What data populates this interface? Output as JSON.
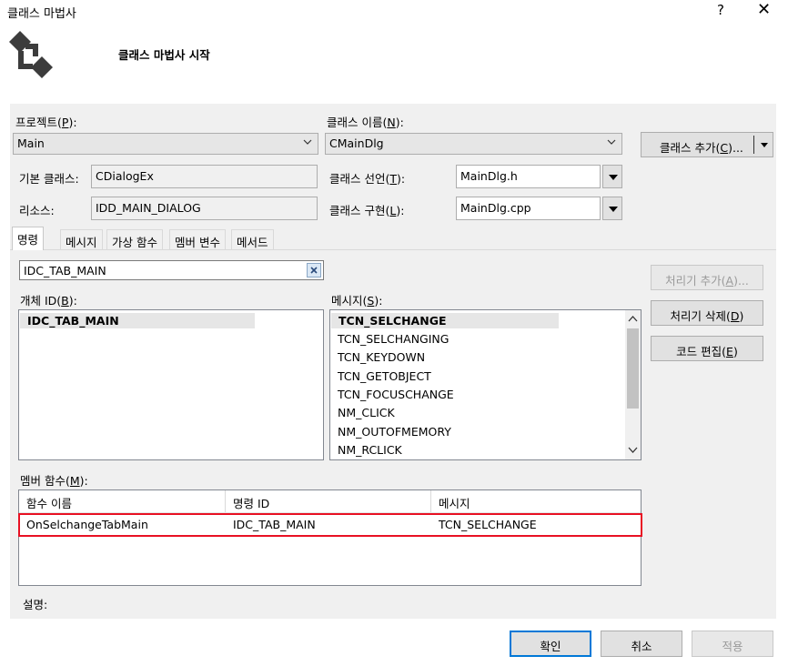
{
  "window": {
    "title": "클래스 마법사",
    "help": "?",
    "close": "✕"
  },
  "header": {
    "title": "클래스 마법사 시작"
  },
  "form": {
    "project_label": "프로젝트(",
    "project_key": "P",
    "project_close": "):",
    "project_value": "Main",
    "classname_label": "클래스 이름(",
    "classname_key": "N",
    "classname_close": "):",
    "classname_value": "CMainDlg",
    "add_class_label": "클래스 추가(",
    "add_class_key": "C",
    "add_class_close": ")...",
    "base_label": "기본 클래스:",
    "base_value": "CDialogEx",
    "decl_label": "클래스 선언(",
    "decl_key": "T",
    "decl_close": "):",
    "decl_value": "MainDlg.h",
    "resource_label": "리소스:",
    "resource_value": "IDD_MAIN_DIALOG",
    "impl_label": "클래스 구현(",
    "impl_key": "L",
    "impl_close": "):",
    "impl_value": "MainDlg.cpp"
  },
  "tabs": [
    "명령",
    "메시지",
    "가상 함수",
    "멤버 변수",
    "메서드"
  ],
  "search": {
    "value": "IDC_TAB_MAIN"
  },
  "object_ids": {
    "label": "개체 ID(",
    "key": "B",
    "close": "):",
    "items": [
      "IDC_TAB_MAIN"
    ]
  },
  "messages": {
    "label": "메시지(",
    "key": "S",
    "close": "):",
    "items": [
      "TCN_SELCHANGE",
      "TCN_SELCHANGING",
      "TCN_KEYDOWN",
      "TCN_GETOBJECT",
      "TCN_FOCUSCHANGE",
      "NM_CLICK",
      "NM_OUTOFMEMORY",
      "NM_RCLICK"
    ]
  },
  "side_buttons": {
    "add_handler": "처리기 추가(",
    "add_handler_key": "A",
    "add_handler_close": ")...",
    "delete_handler": "처리기 삭제(",
    "delete_handler_key": "D",
    "delete_handler_close": ")",
    "edit_code": "코드 편집(",
    "edit_code_key": "E",
    "edit_code_close": ")"
  },
  "members": {
    "label": "멤버 함수(",
    "key": "M",
    "close": "):",
    "columns": [
      "함수 이름",
      "명령 ID",
      "메시지"
    ],
    "rows": [
      [
        "OnSelchangeTabMain",
        "IDC_TAB_MAIN",
        "TCN_SELCHANGE"
      ]
    ],
    "highlight_color": "#e81123"
  },
  "description_label": "설명:",
  "footer": {
    "ok": "확인",
    "cancel": "취소",
    "apply": "적용"
  },
  "colors": {
    "panel": "#f0f0f0",
    "accent": "#0078d7"
  }
}
